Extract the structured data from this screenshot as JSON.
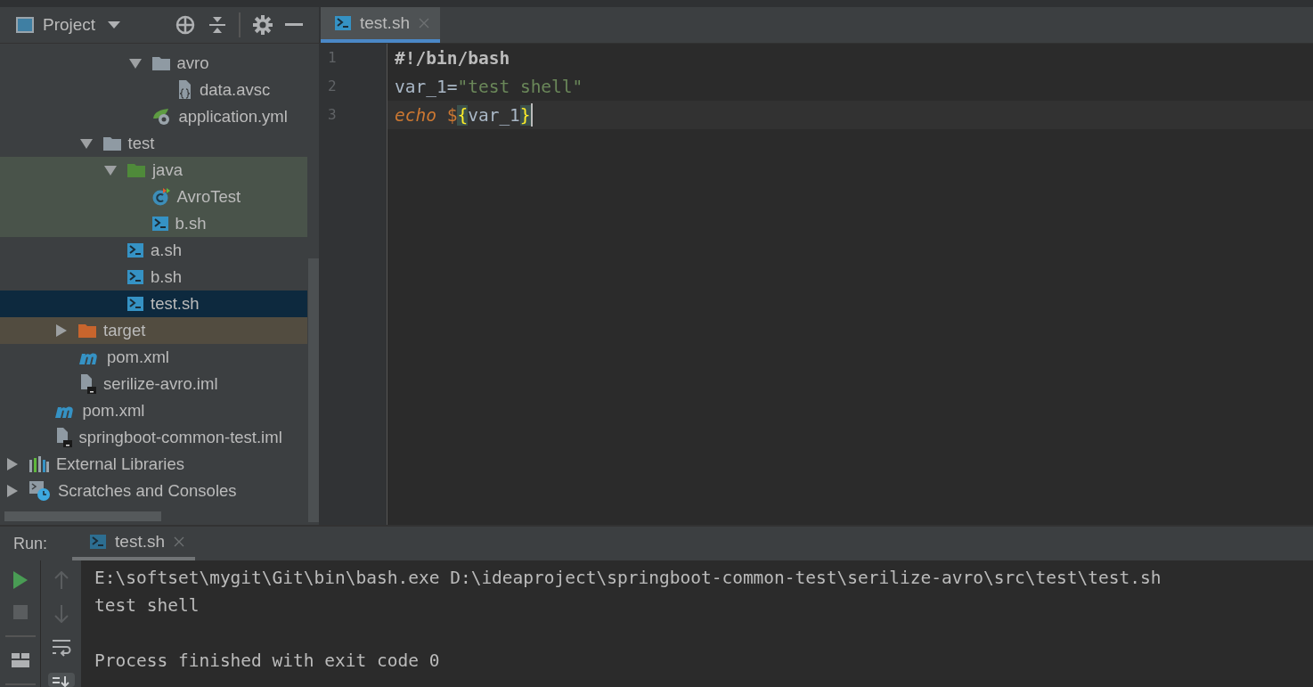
{
  "project_panel": {
    "title": "Project",
    "tree": [
      {
        "children": [
          {
            "children": [
              {
                "children": [
                  {
                    "children": [
                      {
                        "children": [
                          {
                            "label": "avro",
                            "kind": "folder",
                            "expanded": true,
                            "children": [
                              {
                                "label": "data.avsc",
                                "kind": "schema-file"
                              }
                            ]
                          },
                          {
                            "label": "application.yml",
                            "kind": "spring-config"
                          }
                        ]
                      }
                    ]
                  },
                  {
                    "label": "test",
                    "kind": "folder",
                    "expanded": true,
                    "children": [
                      {
                        "label": "java",
                        "kind": "test-source-folder",
                        "expanded": true,
                        "children": [
                          {
                            "label": "AvroTest",
                            "kind": "java-class"
                          },
                          {
                            "label": "b.sh",
                            "kind": "shell"
                          }
                        ]
                      },
                      {
                        "label": "a.sh",
                        "kind": "shell"
                      },
                      {
                        "label": "b.sh",
                        "kind": "shell"
                      },
                      {
                        "label": "test.sh",
                        "kind": "shell",
                        "selected": true
                      }
                    ]
                  }
                ]
              },
              {
                "label": "target",
                "kind": "excluded-folder",
                "expanded": false
              },
              {
                "label": "pom.xml",
                "kind": "maven"
              },
              {
                "label": "serilize-avro.iml",
                "kind": "module-file"
              }
            ]
          },
          {
            "label": "pom.xml",
            "kind": "maven"
          },
          {
            "label": "springboot-common-test.iml",
            "kind": "module-file"
          }
        ]
      },
      {
        "label": "External Libraries",
        "kind": "libraries",
        "expanded": false
      },
      {
        "label": "Scratches and Consoles",
        "kind": "scratches",
        "expanded": false
      }
    ]
  },
  "editor": {
    "tabs": [
      {
        "label": "test.sh",
        "selected": true
      }
    ],
    "lines": [
      {
        "number": "1",
        "current": false,
        "tokens": [
          {
            "kind": "shebang",
            "text": "#!/bin/bash"
          }
        ]
      },
      {
        "number": "2",
        "current": false,
        "tokens": [
          {
            "kind": "plain",
            "text": "var_1="
          },
          {
            "kind": "string",
            "text": "\"test shell\""
          }
        ]
      },
      {
        "number": "3",
        "current": true,
        "tokens": [
          {
            "kind": "keyword",
            "text": "echo"
          },
          {
            "kind": "dollar",
            "text": "$"
          },
          {
            "kind": "brace-match",
            "text": "{"
          },
          {
            "kind": "plain",
            "text": "var_1"
          },
          {
            "kind": "brace-match",
            "text": "}"
          }
        ]
      }
    ]
  },
  "run_panel": {
    "label": "Run:",
    "tabs": [
      {
        "label": "test.sh",
        "selected": true
      }
    ],
    "console": [
      {
        "text": "E:\\softset\\mygit\\Git\\bin\\bash.exe D:\\ideaproject\\springboot-common-test\\serilize-avro\\src\\test\\test.sh",
        "gap_before": false
      },
      {
        "text": "test shell",
        "gap_before": false
      },
      {
        "text": "Process finished with exit code 0",
        "gap_before": true
      }
    ]
  }
}
